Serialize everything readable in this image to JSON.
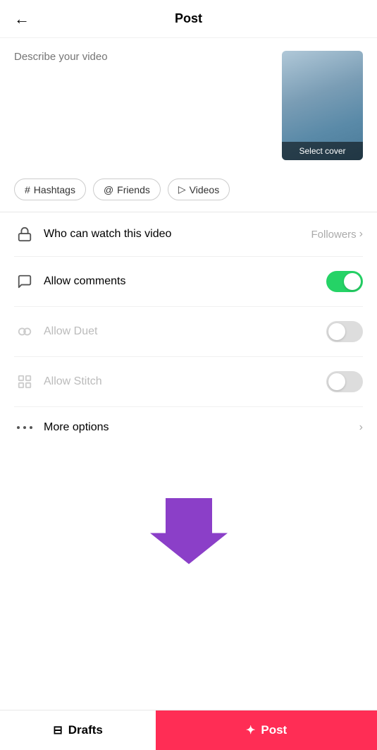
{
  "header": {
    "back_label": "←",
    "title": "Post"
  },
  "description": {
    "placeholder": "Describe your video",
    "value": ""
  },
  "video_thumbnail": {
    "select_cover_label": "Select cover"
  },
  "tags": [
    {
      "id": "hashtags",
      "icon": "#",
      "icon_type": "hash",
      "label": "Hashtags"
    },
    {
      "id": "friends",
      "icon": "@",
      "icon_type": "at",
      "label": "Friends"
    },
    {
      "id": "videos",
      "icon": "▷",
      "icon_type": "play",
      "label": "Videos"
    }
  ],
  "settings": [
    {
      "id": "who-can-watch",
      "icon": "lock",
      "label": "Who can watch this video",
      "value": "Followers",
      "type": "nav",
      "dimmed": false
    },
    {
      "id": "allow-comments",
      "icon": "comment",
      "label": "Allow comments",
      "value": "",
      "type": "toggle",
      "toggle_on": true,
      "dimmed": false
    },
    {
      "id": "allow-duet",
      "icon": "duet",
      "label": "Allow Duet",
      "value": "",
      "type": "toggle",
      "toggle_on": false,
      "dimmed": true
    },
    {
      "id": "allow-stitch",
      "icon": "stitch",
      "label": "Allow Stitch",
      "value": "",
      "type": "toggle",
      "toggle_on": false,
      "dimmed": true
    },
    {
      "id": "more-options",
      "icon": "more",
      "label": "More options",
      "value": "",
      "type": "nav",
      "dimmed": false
    }
  ],
  "bottom_bar": {
    "drafts_label": "Drafts",
    "post_label": "Post"
  },
  "colors": {
    "toggle_on": "#25D366",
    "post_btn": "#ff2d55"
  }
}
